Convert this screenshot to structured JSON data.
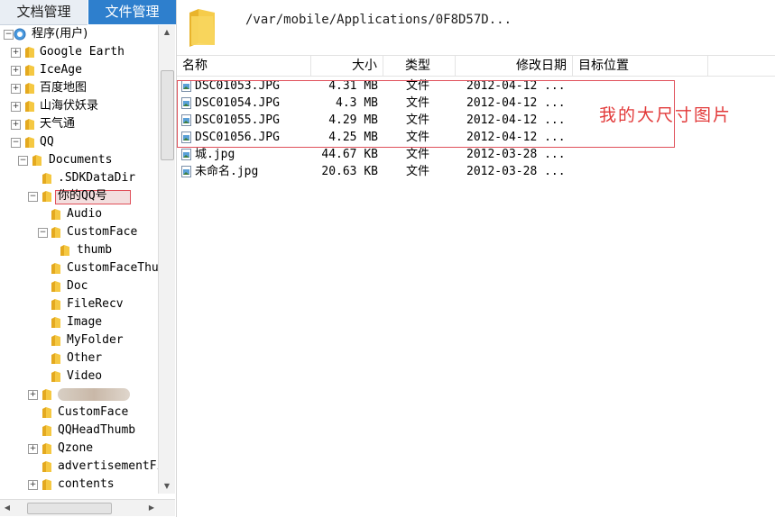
{
  "tabs": {
    "doc_mgmt": "文档管理",
    "file_mgmt": "文件管理"
  },
  "tree": {
    "root_label": "程序(用户)",
    "items": [
      {
        "label": "Google Earth",
        "indent": 1,
        "expander": "+"
      },
      {
        "label": "IceAge",
        "indent": 1,
        "expander": "+"
      },
      {
        "label": "百度地图",
        "indent": 1,
        "expander": "+"
      },
      {
        "label": "山海伏妖录",
        "indent": 1,
        "expander": "+"
      },
      {
        "label": "天气通",
        "indent": 1,
        "expander": "+"
      },
      {
        "label": "QQ",
        "indent": 1,
        "expander": "-"
      },
      {
        "label": "Documents",
        "indent": 2,
        "expander": "-"
      },
      {
        "label": ".SDKDataDir",
        "indent": 3,
        "expander": ""
      },
      {
        "label": "你的QQ号",
        "indent": 3,
        "expander": "-",
        "selected": true
      },
      {
        "label": "Audio",
        "indent": 4,
        "expander": ""
      },
      {
        "label": "CustomFace",
        "indent": 4,
        "expander": "-"
      },
      {
        "label": "thumb",
        "indent": 5,
        "expander": ""
      },
      {
        "label": "CustomFaceThumb",
        "indent": 4,
        "expander": ""
      },
      {
        "label": "Doc",
        "indent": 4,
        "expander": ""
      },
      {
        "label": "FileRecv",
        "indent": 4,
        "expander": ""
      },
      {
        "label": "Image",
        "indent": 4,
        "expander": ""
      },
      {
        "label": "MyFolder",
        "indent": 4,
        "expander": ""
      },
      {
        "label": "Other",
        "indent": 4,
        "expander": ""
      },
      {
        "label": "Video",
        "indent": 4,
        "expander": ""
      },
      {
        "label": "",
        "indent": 3,
        "expander": "+",
        "blurred": true
      },
      {
        "label": "CustomFace",
        "indent": 3,
        "expander": ""
      },
      {
        "label": "QQHeadThumb",
        "indent": 3,
        "expander": ""
      },
      {
        "label": "Qzone",
        "indent": 3,
        "expander": "+"
      },
      {
        "label": "advertisementFile",
        "indent": 3,
        "expander": ""
      },
      {
        "label": "contents",
        "indent": 3,
        "expander": "+"
      }
    ]
  },
  "path": "/var/mobile/Applications/0F8D57D...",
  "columns": {
    "name": "名称",
    "size": "大小",
    "type": "类型",
    "modified": "修改日期",
    "target": "目标位置"
  },
  "files": [
    {
      "name": "DSC01053.JPG",
      "size": "4.31 MB",
      "type": "文件",
      "modified": "2012-04-12 ..."
    },
    {
      "name": "DSC01054.JPG",
      "size": "4.3 MB",
      "type": "文件",
      "modified": "2012-04-12 ..."
    },
    {
      "name": "DSC01055.JPG",
      "size": "4.29 MB",
      "type": "文件",
      "modified": "2012-04-12 ..."
    },
    {
      "name": "DSC01056.JPG",
      "size": "4.25 MB",
      "type": "文件",
      "modified": "2012-04-12 ..."
    },
    {
      "name": "城.jpg",
      "size": "44.67 KB",
      "type": "文件",
      "modified": "2012-03-28 ..."
    },
    {
      "name": "未命名.jpg",
      "size": "20.63 KB",
      "type": "文件",
      "modified": "2012-03-28 ..."
    }
  ],
  "annotation": "我的大尺寸图片",
  "colors": {
    "tab_active": "#2e7fcd",
    "annotation_red": "#e23a3a",
    "folder_yellow": "#f3c33b"
  }
}
